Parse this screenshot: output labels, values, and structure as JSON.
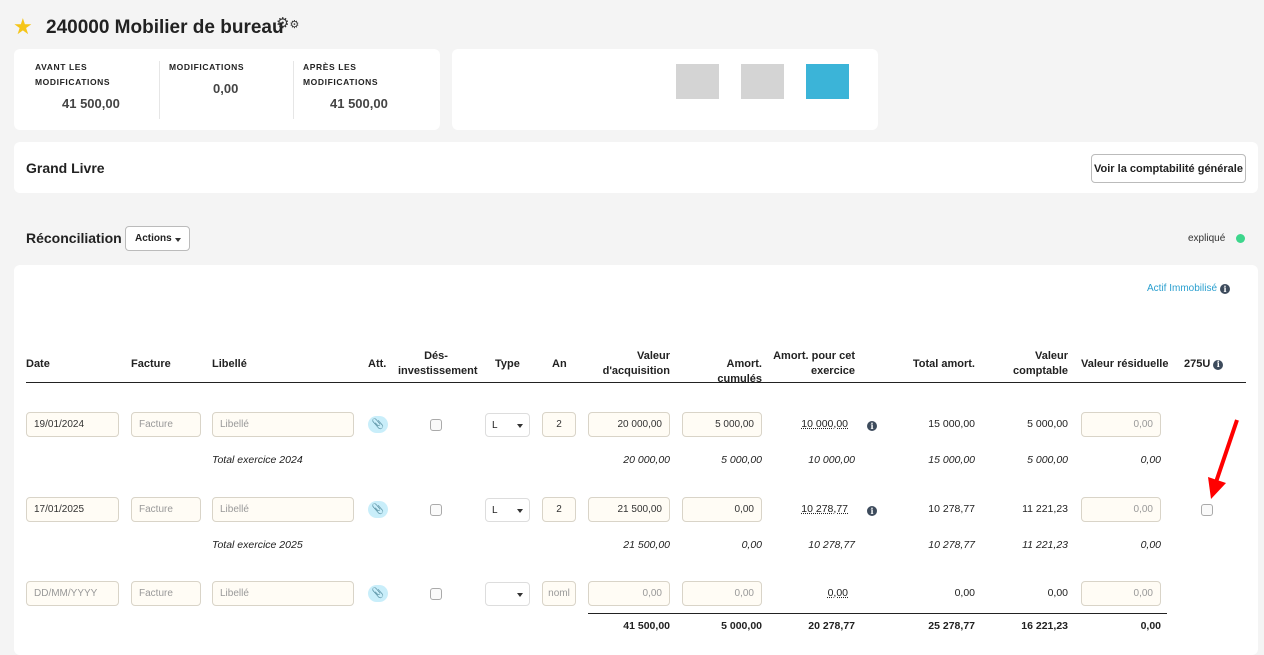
{
  "header": {
    "title": "240000 Mobilier de bureau"
  },
  "stats": [
    {
      "label1": "AVANT LES",
      "label2": "MODIFICATIONS",
      "value": "41 500,00"
    },
    {
      "label1": "MODIFICATIONS",
      "label2": "",
      "value": "0,00"
    },
    {
      "label1": "APRÈS LES",
      "label2": "MODIFICATIONS",
      "value": "41 500,00"
    }
  ],
  "colors": {
    "accent": "#3bb4d8",
    "gray": "#d4d4d4",
    "status": "#3dd68c",
    "arrow": "#f00"
  },
  "ledger": {
    "title": "Grand Livre",
    "button": "Voir la comptabilité générale"
  },
  "reco": {
    "title": "Réconciliation",
    "actions": "Actions",
    "status": "expliqué",
    "link": "Actif Immobilisé"
  },
  "columns": {
    "date": "Date",
    "facture": "Facture",
    "libelle": "Libellé",
    "att": "Att.",
    "des1": "Dés-",
    "des2": "investissement",
    "type": "Type",
    "an": "An",
    "va1": "Valeur",
    "va2": "d'acquisition",
    "ac": "Amort. cumulés",
    "ae1": "Amort. pour cet",
    "ae2": "exercice",
    "ta": "Total amort.",
    "vc1": "Valeur",
    "vc2": "comptable",
    "vr": "Valeur résiduelle",
    "u": "275U"
  },
  "rows": [
    {
      "date": "19/01/2024",
      "facture": "Facture",
      "libelle": "Libellé",
      "type": "L",
      "an": "2",
      "va": "20 000,00",
      "ac": "5 000,00",
      "ae": "10 000,00",
      "ta": "15 000,00",
      "vc": "5 000,00",
      "vr": "0,00",
      "total": {
        "label": "Total exercice 2024",
        "va": "20 000,00",
        "ac": "5 000,00",
        "ae": "10 000,00",
        "ta": "15 000,00",
        "vc": "5 000,00",
        "vr": "0,00"
      }
    },
    {
      "date": "17/01/2025",
      "facture": "Facture",
      "libelle": "Libellé",
      "type": "L",
      "an": "2",
      "va": "21 500,00",
      "ac": "0,00",
      "ae": "10 278,77",
      "ta": "10 278,77",
      "vc": "11 221,23",
      "vr": "0,00",
      "total": {
        "label": "Total exercice 2025",
        "va": "21 500,00",
        "ac": "0,00",
        "ae": "10 278,77",
        "ta": "10 278,77",
        "vc": "11 221,23",
        "vr": "0,00"
      }
    },
    {
      "date": "DD/MM/YYYY",
      "facture": "Facture",
      "libelle": "Libellé",
      "type": "",
      "an": "noml",
      "va": "0,00",
      "ac": "0,00",
      "ae": "0,00",
      "ta": "0,00",
      "vc": "0,00",
      "vr": "0,00"
    }
  ],
  "grand_total": {
    "va": "41 500,00",
    "ac": "5 000,00",
    "ae": "20 278,77",
    "ta": "25 278,77",
    "vc": "16 221,23",
    "vr": "0,00"
  }
}
